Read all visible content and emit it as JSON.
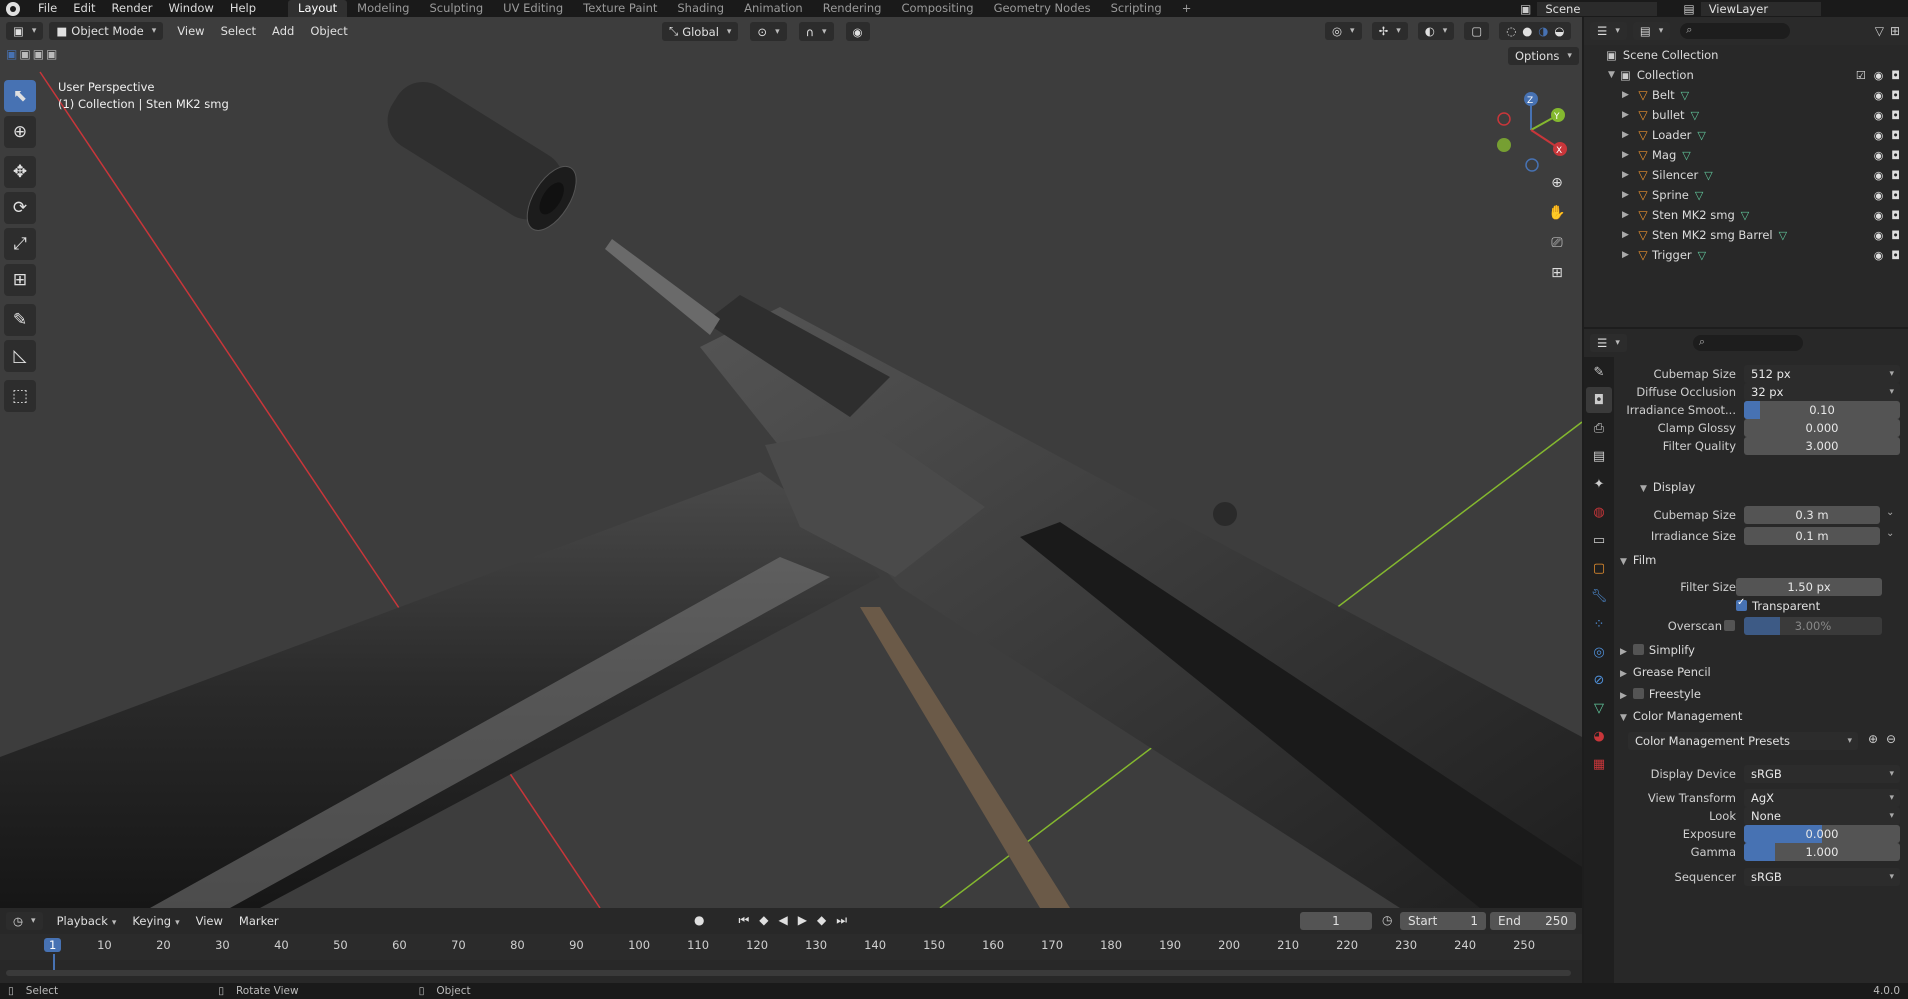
{
  "menubar": {
    "menus": [
      "File",
      "Edit",
      "Render",
      "Window",
      "Help"
    ],
    "workspaces": [
      "Layout",
      "Modeling",
      "Sculpting",
      "UV Editing",
      "Texture Paint",
      "Shading",
      "Animation",
      "Rendering",
      "Compositing",
      "Geometry Nodes",
      "Scripting"
    ],
    "active_workspace": "Layout",
    "add_tab": "+",
    "scene": "Scene",
    "view_layer": "ViewLayer"
  },
  "viewport": {
    "mode": "Object Mode",
    "menus": [
      "View",
      "Select",
      "Add",
      "Object"
    ],
    "orientation": "Global",
    "options_label": "Options",
    "overlay_line1": "User Perspective",
    "overlay_line2": "(1) Collection | Sten MK2 smg",
    "gizmo_axes": {
      "x": "X",
      "y": "Y",
      "z": "Z"
    }
  },
  "outliner": {
    "root": "Scene Collection",
    "collection": "Collection",
    "items": [
      {
        "name": "Belt"
      },
      {
        "name": "bullet"
      },
      {
        "name": "Loader"
      },
      {
        "name": "Mag"
      },
      {
        "name": "Silencer"
      },
      {
        "name": "Sprine"
      },
      {
        "name": "Sten MK2 smg"
      },
      {
        "name": "Sten MK2 smg Barrel"
      },
      {
        "name": "Trigger"
      }
    ]
  },
  "properties": {
    "fields": [
      {
        "label": "Cubemap Size",
        "value": "512 px",
        "type": "dropdown"
      },
      {
        "label": "Diffuse Occlusion",
        "value": "32 px",
        "type": "dropdown"
      },
      {
        "label": "Irradiance Smoot...",
        "value": "0.10",
        "type": "slider",
        "fill": 0.1
      },
      {
        "label": "Clamp Glossy",
        "value": "0.000",
        "type": "number"
      },
      {
        "label": "Filter Quality",
        "value": "3.000",
        "type": "number"
      }
    ],
    "display_section": "Display",
    "display_fields": [
      {
        "label": "Cubemap Size",
        "value": "0.3 m"
      },
      {
        "label": "Irradiance Size",
        "value": "0.1 m"
      }
    ],
    "film_section": "Film",
    "filter_size_label": "Filter Size",
    "filter_size_value": "1.50 px",
    "transparent_label": "Transparent",
    "overscan_label": "Overscan",
    "overscan_value": "3.00%",
    "collapsed_sections": [
      "Simplify",
      "Grease Pencil",
      "Freestyle"
    ],
    "color_mgmt_section": "Color Management",
    "color_mgmt_presets": "Color Management Presets",
    "cm_fields": [
      {
        "label": "Display Device",
        "value": "sRGB",
        "type": "dropdown"
      },
      {
        "label": "View Transform",
        "value": "AgX",
        "type": "dropdown"
      },
      {
        "label": "Look",
        "value": "None",
        "type": "dropdown"
      },
      {
        "label": "Exposure",
        "value": "0.000",
        "type": "slider",
        "fill": 0.5
      },
      {
        "label": "Gamma",
        "value": "1.000",
        "type": "slider",
        "fill": 0.2
      },
      {
        "label": "Sequencer",
        "value": "sRGB",
        "type": "dropdown"
      }
    ],
    "version": "4.0.0"
  },
  "timeline": {
    "menus": [
      "Playback",
      "Keying",
      "View",
      "Marker"
    ],
    "current_frame": "1",
    "start_label": "Start",
    "start_value": "1",
    "end_label": "End",
    "end_value": "250",
    "ticks": [
      "1",
      "10",
      "20",
      "30",
      "40",
      "50",
      "60",
      "70",
      "80",
      "90",
      "100",
      "110",
      "120",
      "130",
      "140",
      "150",
      "160",
      "170",
      "180",
      "190",
      "200",
      "210",
      "220",
      "230",
      "240",
      "250"
    ]
  },
  "statusbar": {
    "items": [
      "Select",
      "Rotate View",
      "Object"
    ]
  },
  "colors": {
    "accent": "#4772b3",
    "viewport_bg": "#3d3d3d",
    "panel_bg": "#282828",
    "object_orange": "#e8912f",
    "mesh_green": "#62c99d",
    "x_axis": "#c8363a",
    "y_axis": "#84b82f"
  }
}
